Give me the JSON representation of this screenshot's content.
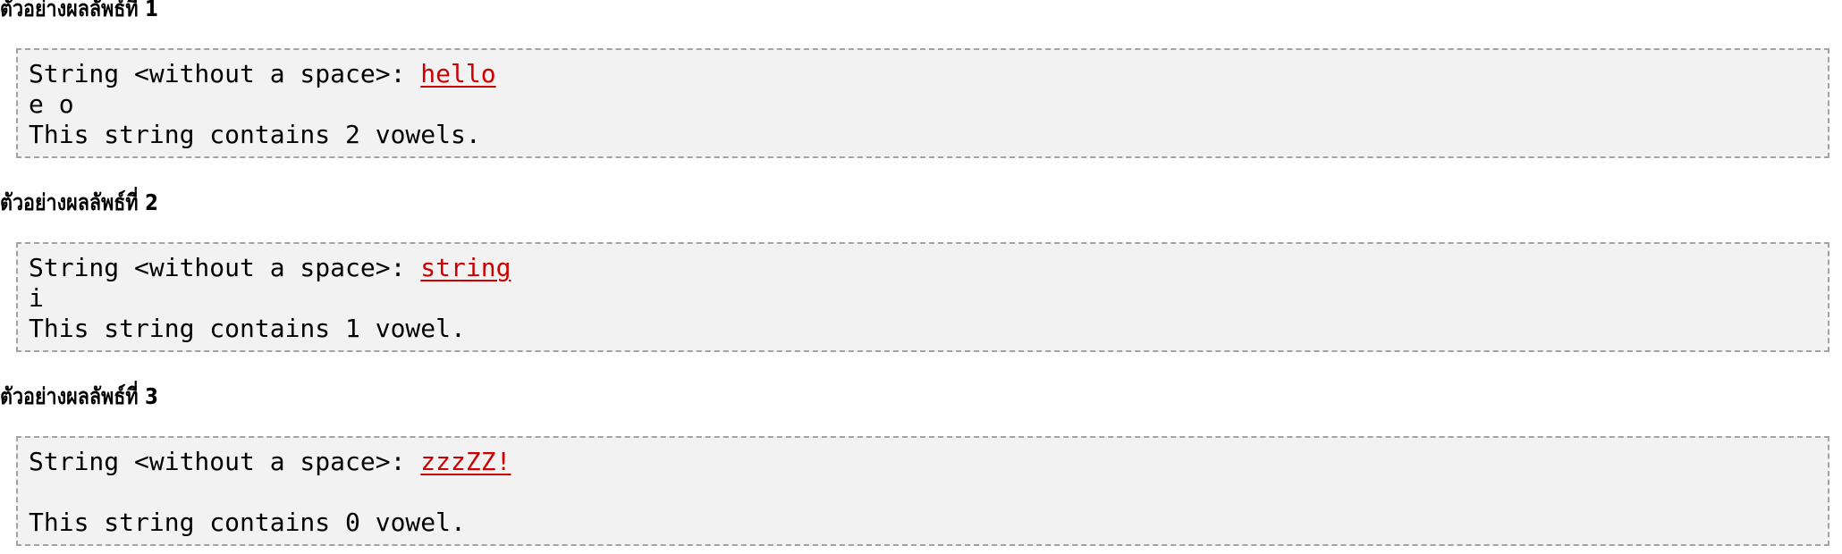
{
  "examples": [
    {
      "heading": "ตัวอย่างผลลัพธ์ที่ 1",
      "prompt": "String <without a space>: ",
      "input": "hello",
      "vowels_line": "e o",
      "result": "This string contains 2 vowels."
    },
    {
      "heading": "ตัวอย่างผลลัพธ์ที่ 2",
      "prompt": "String <without a space>: ",
      "input": "string",
      "vowels_line": "i",
      "result": "This string contains 1 vowel."
    },
    {
      "heading": "ตัวอย่างผลลัพธ์ที่ 3",
      "prompt": "String <without a space>: ",
      "input": "zzzZZ!",
      "vowels_line": "",
      "result": "This string contains 0 vowel."
    }
  ],
  "colors": {
    "input_text": "#cc0000",
    "box_background": "#f2f2f2",
    "box_border": "#a3a3a3"
  }
}
